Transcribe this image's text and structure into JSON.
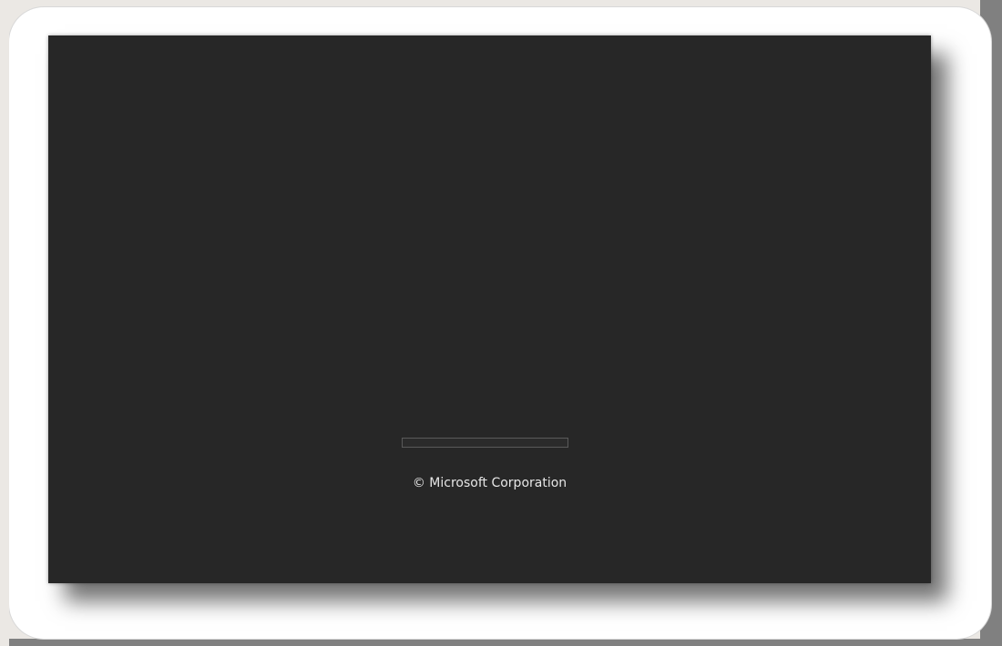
{
  "splash": {
    "copyright_text": "© Microsoft Corporation",
    "progress_fraction": 0.0
  },
  "colors": {
    "splash_background": "#272727",
    "text": "#e6e6e6",
    "progress_border": "#5a5a5a",
    "frame_background": "#ebe8e4",
    "backdrop_white": "#ffffff"
  }
}
